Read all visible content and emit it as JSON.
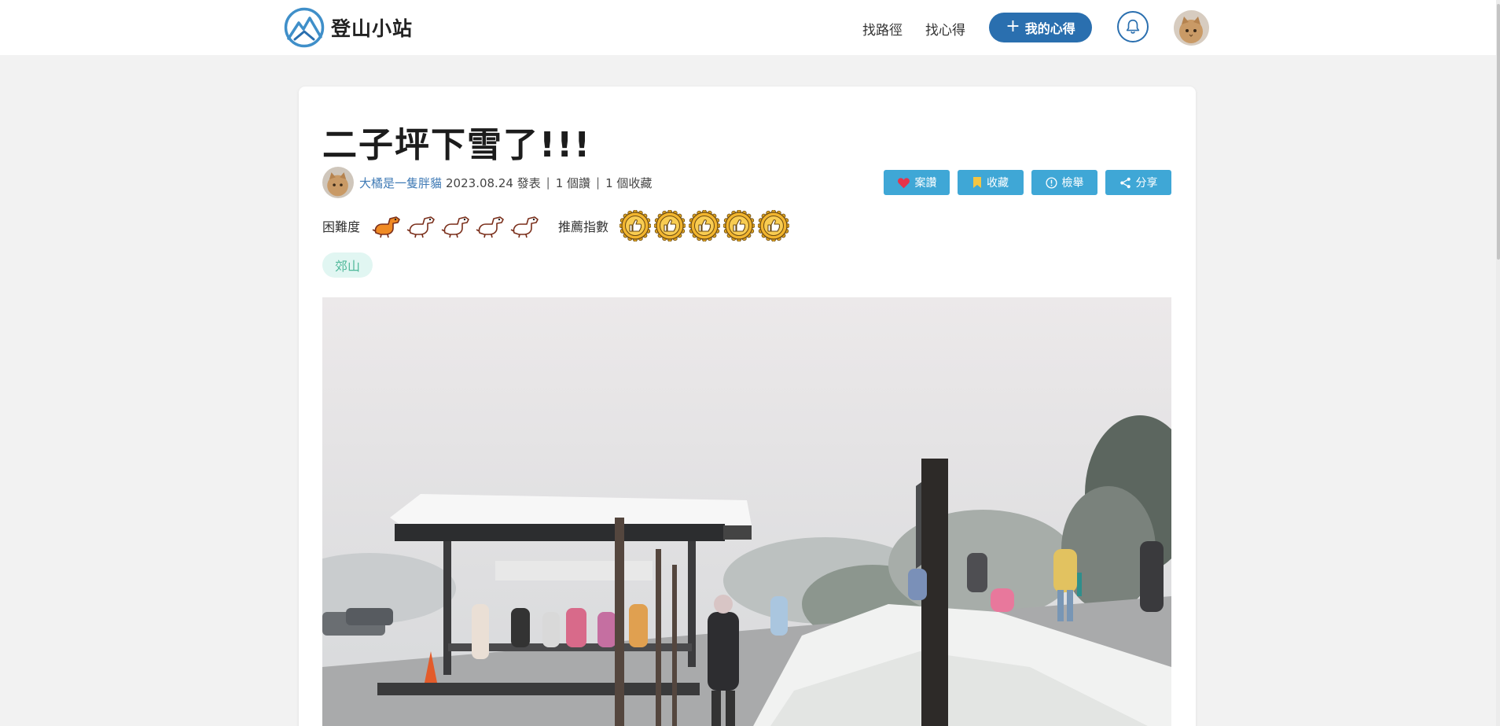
{
  "site": {
    "name": "登山小站"
  },
  "nav": {
    "routes": "找路徑",
    "posts": "找心得",
    "my_posts": "我的心得"
  },
  "post": {
    "title": "二子坪下雪了!!!",
    "author": "大橘是一隻胖貓",
    "date_text": "2023.08.24 發表",
    "likes": "1 個讚",
    "saves": "1 個收藏",
    "actions": {
      "like": "案讚",
      "save": "收藏",
      "report": "檢舉",
      "share": "分享"
    },
    "difficulty_label": "困難度",
    "difficulty_level": 1,
    "difficulty_max": 5,
    "recommend_label": "推薦指數",
    "recommend_level": 5,
    "tag": "郊山"
  },
  "colors": {
    "brand": "#2a6faf",
    "action": "#3fa7d6",
    "tag_bg": "#e1f6f2",
    "tag_text": "#4fb89a"
  }
}
